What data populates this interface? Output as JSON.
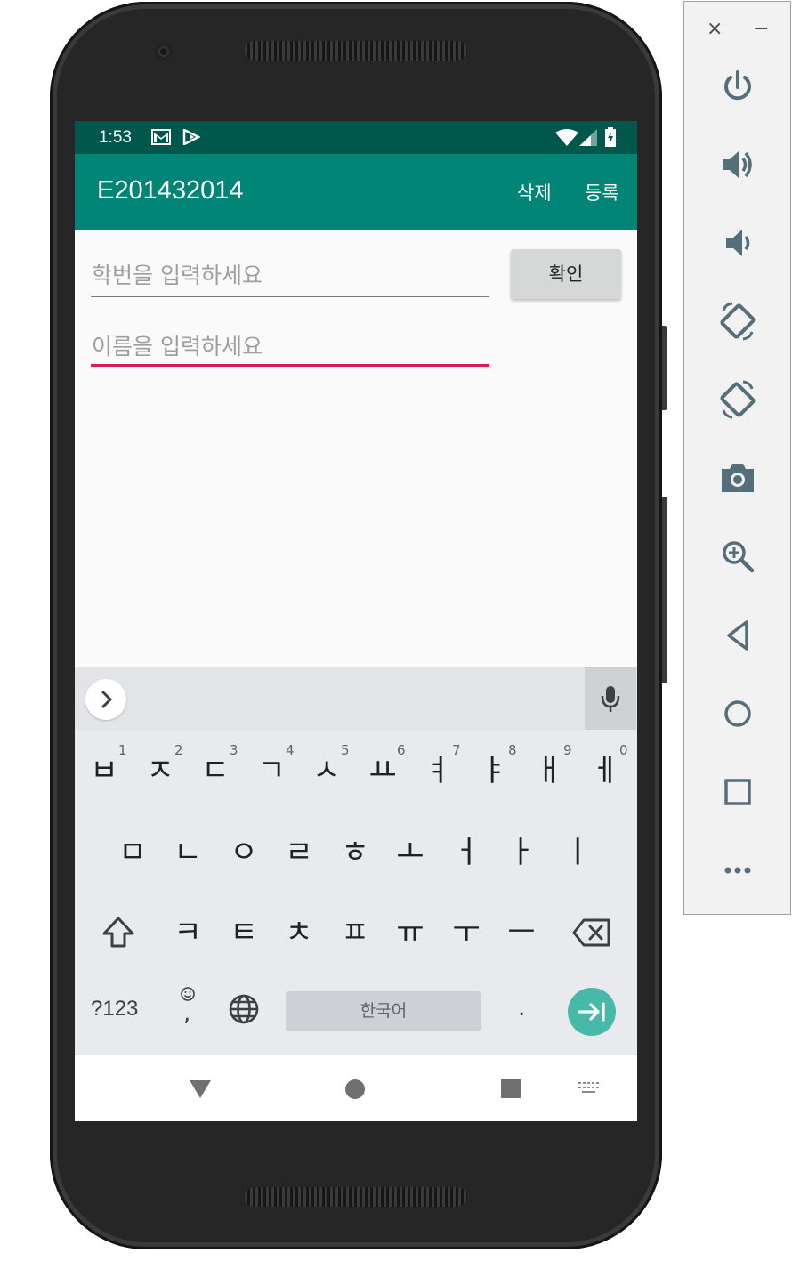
{
  "status_bar": {
    "time": "1:53",
    "icons": [
      "gmail-icon",
      "play-store-icon",
      "wifi-icon",
      "signal-icon",
      "battery-icon"
    ]
  },
  "app_bar": {
    "title": "E201432014",
    "menu": [
      "삭제",
      "등록"
    ]
  },
  "form": {
    "student_id_placeholder": "학번을 입력하세요",
    "name_placeholder": "이름을 입력하세요",
    "confirm_label": "확인"
  },
  "keyboard": {
    "number_hints": [
      "1",
      "2",
      "3",
      "4",
      "5",
      "6",
      "7",
      "8",
      "9",
      "0"
    ],
    "row1": [
      "ㅂ",
      "ㅈ",
      "ㄷ",
      "ㄱ",
      "ㅅ",
      "ㅛ",
      "ㅕ",
      "ㅑ",
      "ㅐ",
      "ㅔ"
    ],
    "row2": [
      "ㅁ",
      "ㄴ",
      "ㅇ",
      "ㄹ",
      "ㅎ",
      "ㅗ",
      "ㅓ",
      "ㅏ",
      "ㅣ"
    ],
    "row3": [
      "ㅋ",
      "ㅌ",
      "ㅊ",
      "ㅍ",
      "ㅠ",
      "ㅜ",
      "ㅡ"
    ],
    "symbols_label": "?123",
    "emoji_comma": ",",
    "space_label": "한국어",
    "period_label": "."
  },
  "emulator_toolbar": {
    "close_glyph": "×",
    "minimize_glyph": "−",
    "buttons": [
      "power-icon",
      "volume-up-icon",
      "volume-down-icon",
      "rotate-left-icon",
      "rotate-right-icon",
      "camera-icon",
      "zoom-icon",
      "back-icon",
      "home-icon",
      "overview-icon",
      "more-icon"
    ]
  },
  "colors": {
    "status_bar": "#00574b",
    "app_bar": "#008577",
    "accent": "#d81b60",
    "enter_key": "#48b8a8"
  }
}
